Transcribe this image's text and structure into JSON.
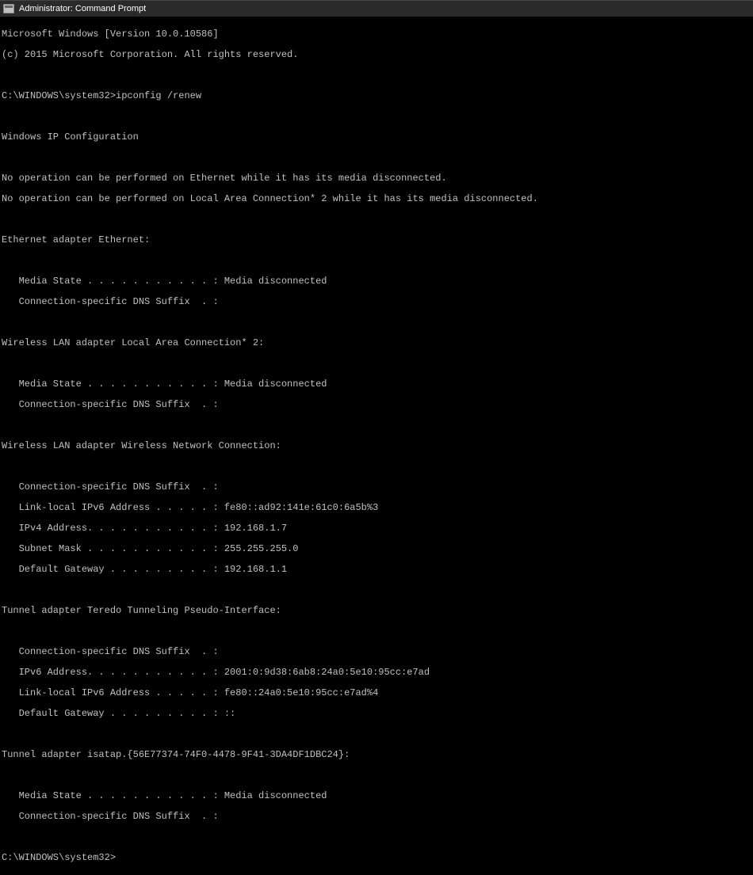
{
  "titlebar": {
    "title": "Administrator: Command Prompt"
  },
  "lines": {
    "l0": "Microsoft Windows [Version 10.0.10586]",
    "l1": "(c) 2015 Microsoft Corporation. All rights reserved.",
    "l2": "",
    "l3": "C:\\WINDOWS\\system32>ipconfig /renew",
    "l4": "",
    "l5": "Windows IP Configuration",
    "l6": "",
    "l7": "No operation can be performed on Ethernet while it has its media disconnected.",
    "l8": "No operation can be performed on Local Area Connection* 2 while it has its media disconnected.",
    "l9": "",
    "l10": "Ethernet adapter Ethernet:",
    "l11": "",
    "l12": "   Media State . . . . . . . . . . . : Media disconnected",
    "l13": "   Connection-specific DNS Suffix  . :",
    "l14": "",
    "l15": "Wireless LAN adapter Local Area Connection* 2:",
    "l16": "",
    "l17": "   Media State . . . . . . . . . . . : Media disconnected",
    "l18": "   Connection-specific DNS Suffix  . :",
    "l19": "",
    "l20": "Wireless LAN adapter Wireless Network Connection:",
    "l21": "",
    "l22": "   Connection-specific DNS Suffix  . :",
    "l23": "   Link-local IPv6 Address . . . . . : fe80::ad92:141e:61c0:6a5b%3",
    "l24": "   IPv4 Address. . . . . . . . . . . : 192.168.1.7",
    "l25": "   Subnet Mask . . . . . . . . . . . : 255.255.255.0",
    "l26": "   Default Gateway . . . . . . . . . : 192.168.1.1",
    "l27": "",
    "l28": "Tunnel adapter Teredo Tunneling Pseudo-Interface:",
    "l29": "",
    "l30": "   Connection-specific DNS Suffix  . :",
    "l31": "   IPv6 Address. . . . . . . . . . . : 2001:0:9d38:6ab8:24a0:5e10:95cc:e7ad",
    "l32": "   Link-local IPv6 Address . . . . . : fe80::24a0:5e10:95cc:e7ad%4",
    "l33": "   Default Gateway . . . . . . . . . : ::",
    "l34": "",
    "l35": "Tunnel adapter isatap.{56E77374-74F0-4478-9F41-3DA4DF1DBC24}:",
    "l36": "",
    "l37": "   Media State . . . . . . . . . . . : Media disconnected",
    "l38": "   Connection-specific DNS Suffix  . :",
    "l39": "",
    "l40": "C:\\WINDOWS\\system32>"
  }
}
